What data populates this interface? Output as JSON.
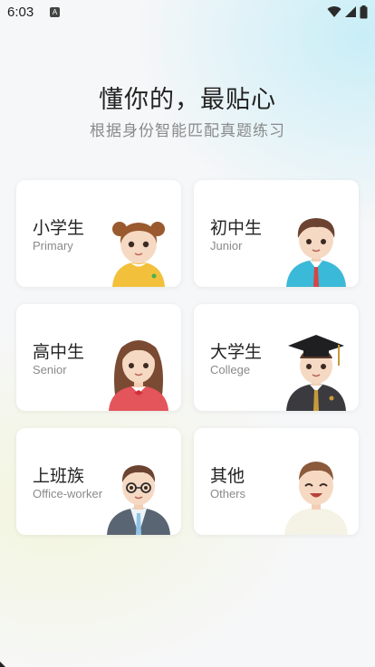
{
  "status_bar": {
    "time": "6:03",
    "notification_badge": "A"
  },
  "header": {
    "title": "懂你的，最贴心",
    "subtitle": "根据身份智能匹配真题练习"
  },
  "cards": [
    {
      "zh": "小学生",
      "en": "Primary"
    },
    {
      "zh": "初中生",
      "en": "Junior"
    },
    {
      "zh": "高中生",
      "en": "Senior"
    },
    {
      "zh": "大学生",
      "en": "College"
    },
    {
      "zh": "上班族",
      "en": "Office-worker"
    },
    {
      "zh": "其他",
      "en": "Others"
    }
  ],
  "colors": {
    "primary_shirt": "#f2c03a",
    "junior_shirt": "#3bb9d8",
    "senior_shirt": "#e3555b",
    "college_gown": "#3b3b3f",
    "office_suit": "#5a6574",
    "others_shirt": "#f5f2e6"
  }
}
